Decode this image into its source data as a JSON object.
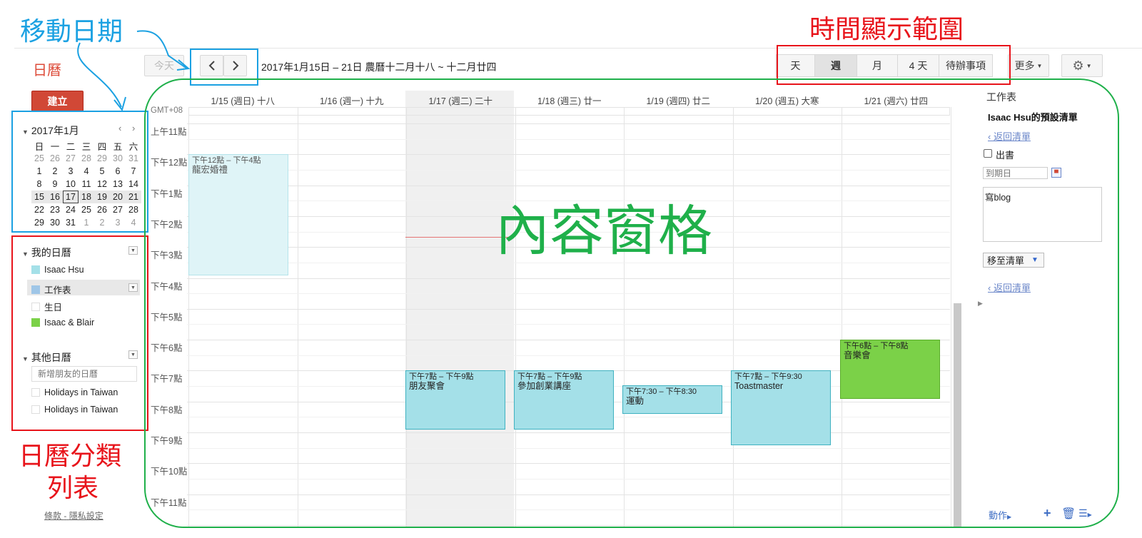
{
  "app": {
    "title": "日曆"
  },
  "toolbar": {
    "today_label": "今天",
    "prev_icon": "chevron-left-icon",
    "next_icon": "chevron-right-icon",
    "date_range": "2017年1月15日 – 21日 農曆十二月十八 ~ 十二月廿四",
    "views": [
      "天",
      "週",
      "月",
      "4 天",
      "待辦事項"
    ],
    "active_view": "週",
    "more_label": "更多",
    "settings_icon": "gear-icon"
  },
  "sidebar": {
    "create_label": "建立",
    "mini_calendar": {
      "month_label": "2017年1月",
      "weekdays": [
        "日",
        "一",
        "二",
        "三",
        "四",
        "五",
        "六"
      ],
      "weeks": [
        [
          "25",
          "26",
          "27",
          "28",
          "29",
          "30",
          "31"
        ],
        [
          "1",
          "2",
          "3",
          "4",
          "5",
          "6",
          "7"
        ],
        [
          "8",
          "9",
          "10",
          "11",
          "12",
          "13",
          "14"
        ],
        [
          "15",
          "16",
          "17",
          "18",
          "19",
          "20",
          "21"
        ],
        [
          "22",
          "23",
          "24",
          "25",
          "26",
          "27",
          "28"
        ],
        [
          "29",
          "30",
          "31",
          "1",
          "2",
          "3",
          "4"
        ]
      ],
      "today": "17"
    },
    "my_calendars": {
      "label": "我的日曆",
      "items": [
        {
          "label": "Isaac Hsu",
          "color": "#a4e0e8"
        },
        {
          "label": "工作表",
          "color": "#9fc6e7"
        },
        {
          "label": "生日",
          "color": "#ffffff"
        },
        {
          "label": "Isaac & Blair",
          "color": "#7bd148"
        }
      ]
    },
    "other_calendars": {
      "label": "其他日曆",
      "add_placeholder": "新增朋友的日曆",
      "items": [
        {
          "label": "Holidays in Taiwan"
        },
        {
          "label": "Holidays in Taiwan"
        }
      ]
    },
    "footer": {
      "terms": "條款",
      "sep": "-",
      "privacy": "隱私設定"
    }
  },
  "week": {
    "timezone": "GMT+08",
    "days": [
      "1/15 (週日) 十八",
      "1/16 (週一) 十九",
      "1/17 (週二) 二十",
      "1/18 (週三) 廿一",
      "1/19 (週四) 廿二",
      "1/20 (週五) 大寒",
      "1/21 (週六) 廿四"
    ],
    "hours": [
      "上午11點",
      "下午12點",
      "下午1點",
      "下午2點",
      "下午3點",
      "下午4點",
      "下午5點",
      "下午6點",
      "下午7點",
      "下午8點",
      "下午9點",
      "下午10點",
      "下午11點"
    ],
    "events": [
      {
        "time": "下午12點 – 下午4點",
        "name": "龍宏婚禮"
      },
      {
        "time": "下午7點 – 下午9點",
        "name": "朋友聚會"
      },
      {
        "time": "下午7點 – 下午9點",
        "name": "參加創業講座"
      },
      {
        "time": "下午7:30 – 下午8:30",
        "name": "運動"
      },
      {
        "time": "下午7點 – 下午9:30",
        "name": "Toastmaster"
      },
      {
        "time": "下午6點 – 下午8點",
        "name": "音樂會"
      }
    ]
  },
  "tasks": {
    "title": "工作表",
    "list_name": "Isaac Hsu的預設清單",
    "back_link": "‹ 返回清單",
    "task_name": "出書",
    "due_placeholder": "到期日",
    "note": "寫blog",
    "move_label": "移至清單",
    "actions_label": "動作",
    "add_icon": "plus-icon",
    "delete_icon": "trash-icon",
    "list_icon": "list-icon"
  },
  "annotations": {
    "move_date": "移動日期",
    "time_range": "時間顯示範圍",
    "category_list": [
      "日曆分類",
      "列表"
    ],
    "content_pane": "內容窗格"
  }
}
